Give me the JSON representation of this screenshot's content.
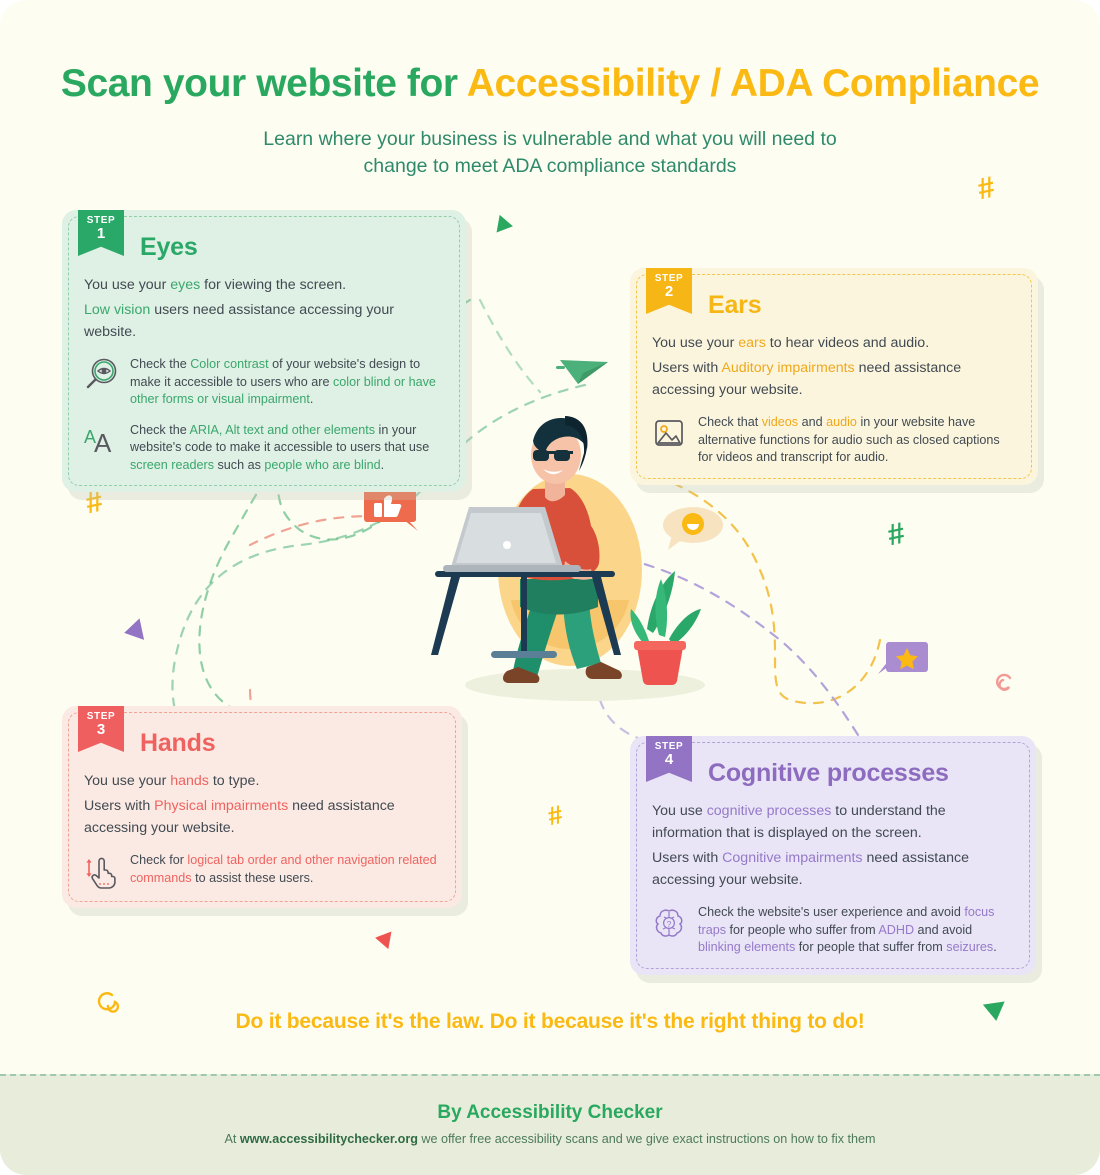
{
  "header": {
    "title_part1": "Scan your website for ",
    "title_part2": "Accessibility / ADA Compliance",
    "subtitle_line1": "Learn where your business is vulnerable and what you will need to",
    "subtitle_line2": "change to meet ADA compliance standards"
  },
  "cards": {
    "eyes": {
      "step_label": "STEP",
      "step_number": "1",
      "title": "Eyes",
      "lede": [
        {
          "pre": "You use your ",
          "hl": "eyes",
          "post": " for viewing the screen."
        },
        {
          "pre": "",
          "hl": "Low vision",
          "post": " users need assistance accessing your website."
        }
      ],
      "bullets": [
        {
          "icon": "magnifier-eye-icon",
          "segments": [
            {
              "text": "Check the ",
              "hl": false
            },
            {
              "text": "Color contrast",
              "hl": true
            },
            {
              "text": " of your website's design to make it accessible to users who are ",
              "hl": false
            },
            {
              "text": "color blind or have other forms or visual impairment",
              "hl": true
            },
            {
              "text": ".",
              "hl": false
            }
          ]
        },
        {
          "icon": "aa-text-icon",
          "segments": [
            {
              "text": "Check the ",
              "hl": false
            },
            {
              "text": "ARIA, Alt text and other elements",
              "hl": true
            },
            {
              "text": " in your website's code to make it accessible to users that use ",
              "hl": false
            },
            {
              "text": "screen readers",
              "hl": true
            },
            {
              "text": " such as ",
              "hl": false
            },
            {
              "text": "people who are blind",
              "hl": true
            },
            {
              "text": ".",
              "hl": false
            }
          ]
        }
      ]
    },
    "ears": {
      "step_label": "STEP",
      "step_number": "2",
      "title": "Ears",
      "lede": [
        {
          "pre": "You use your ",
          "hl": "ears",
          "post": " to hear videos and audio."
        },
        {
          "pre": "Users with ",
          "hl": "Auditory impairments",
          "post": " need assistance accessing your website."
        }
      ],
      "bullets": [
        {
          "icon": "image-placeholder-icon",
          "segments": [
            {
              "text": "Check that ",
              "hl": false
            },
            {
              "text": "videos",
              "hl": true
            },
            {
              "text": " and ",
              "hl": false
            },
            {
              "text": "audio",
              "hl": true
            },
            {
              "text": " in your website have alternative functions for audio such as closed captions for videos and transcript for audio.",
              "hl": false
            }
          ]
        }
      ]
    },
    "hands": {
      "step_label": "STEP",
      "step_number": "3",
      "title": "Hands",
      "lede": [
        {
          "pre": "You use your ",
          "hl": "hands",
          "post": " to type."
        },
        {
          "pre": "Users with ",
          "hl": "Physical impairments",
          "post": " need assistance accessing your website."
        }
      ],
      "bullets": [
        {
          "icon": "pointing-hand-icon",
          "segments": [
            {
              "text": "Check for ",
              "hl": false
            },
            {
              "text": "logical tab order and other navigation related commands",
              "hl": true
            },
            {
              "text": " to assist these users.",
              "hl": false
            }
          ]
        }
      ]
    },
    "cognitive": {
      "step_label": "STEP",
      "step_number": "4",
      "title": "Cognitive processes",
      "lede": [
        {
          "pre": "You use ",
          "hl": "cognitive processes",
          "post": " to understand the information that is displayed on the screen."
        },
        {
          "pre": "Users with ",
          "hl": "Cognitive impairments",
          "post": " need assistance accessing your website."
        }
      ],
      "bullets": [
        {
          "icon": "brain-icon",
          "segments": [
            {
              "text": "Check the website's user experience and avoid ",
              "hl": false
            },
            {
              "text": "focus traps",
              "hl": true
            },
            {
              "text": " for people who suffer from ",
              "hl": false
            },
            {
              "text": "ADHD",
              "hl": true
            },
            {
              "text": " and avoid ",
              "hl": false
            },
            {
              "text": "blinking elements",
              "hl": true
            },
            {
              "text": " for people that suffer from ",
              "hl": false
            },
            {
              "text": "seizures",
              "hl": true
            },
            {
              "text": ".",
              "hl": false
            }
          ]
        }
      ]
    }
  },
  "cta": "Do it because it's the law. Do it because it's the right thing to do!",
  "footer": {
    "title": "By Accessibility Checker",
    "sub_pre": "At ",
    "sub_url": "www.accessibilitychecker.org",
    "sub_post": " we offer free accessibility scans and we give exact instructions on how to fix them"
  },
  "decorations": [
    {
      "name": "hash-yellow-top-right",
      "type": "hash",
      "color": "#fbb914"
    },
    {
      "name": "hash-yellow-left",
      "type": "hash",
      "color": "#fbb914"
    },
    {
      "name": "hash-green-right",
      "type": "hash",
      "color": "#2aa860"
    },
    {
      "name": "hash-yellow-bottom",
      "type": "hash",
      "color": "#fbb914"
    },
    {
      "name": "triangle-green-top",
      "type": "triangle",
      "color": "#2aa860"
    },
    {
      "name": "triangle-purple-left",
      "type": "triangle",
      "color": "#9273c4"
    },
    {
      "name": "triangle-red-bottom",
      "type": "triangle",
      "color": "#ef5350"
    },
    {
      "name": "triangle-green-bottom-right",
      "type": "triangle",
      "color": "#2aa860"
    },
    {
      "name": "spiral-pink",
      "type": "spiral",
      "color": "#f29b94"
    },
    {
      "name": "spiral-yellow",
      "type": "spiral",
      "color": "#fbb914"
    },
    {
      "name": "paper-plane-green",
      "type": "plane",
      "color": "#4cb07a"
    },
    {
      "name": "thumbs-up-bubble",
      "type": "bubble",
      "color": "#ee6b4d"
    },
    {
      "name": "smiley-bubble",
      "type": "bubble",
      "color": "#f7e2bd"
    },
    {
      "name": "star-bubble",
      "type": "bubble",
      "color": "#a98dd0"
    }
  ],
  "colors": {
    "bg": "#fdfdf2",
    "green": "#2aa860",
    "yellow": "#fbb914",
    "red": "#ef6360",
    "purple": "#8d6cc0",
    "footer_bg": "#e8eddb"
  }
}
